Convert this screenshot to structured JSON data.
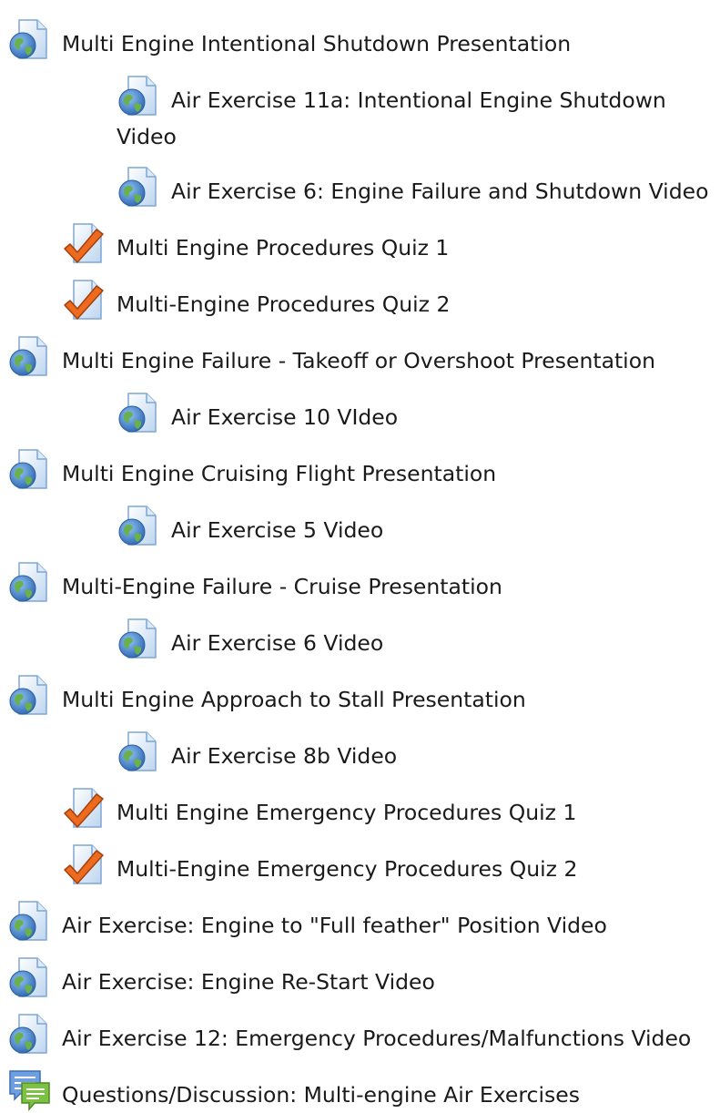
{
  "activities": [
    {
      "label": "Multi Engine Intentional Shutdown Presentation",
      "icon": "url-globe-icon"
    },
    {
      "label": "Air Exercise 11a: Intentional Engine Shutdown Video",
      "icon": "url-globe-icon"
    },
    {
      "label": "Air Exercise 6: Engine Failure and Shutdown Video",
      "icon": "url-globe-icon"
    },
    {
      "label": "Multi Engine Procedures Quiz 1",
      "icon": "quiz-check-icon"
    },
    {
      "label": "Multi-Engine Procedures Quiz 2",
      "icon": "quiz-check-icon"
    },
    {
      "label": "Multi Engine Failure - Takeoff or Overshoot Presentation",
      "icon": "url-globe-icon"
    },
    {
      "label": "Air Exercise 10 VIdeo",
      "icon": "url-globe-icon"
    },
    {
      "label": "Multi Engine Cruising Flight Presentation",
      "icon": "url-globe-icon"
    },
    {
      "label": "Air Exercise 5 Video",
      "icon": "url-globe-icon"
    },
    {
      "label": "Multi-Engine Failure - Cruise Presentation",
      "icon": "url-globe-icon"
    },
    {
      "label": "Air Exercise 6 Video",
      "icon": "url-globe-icon"
    },
    {
      "label": "Multi Engine Approach to Stall Presentation",
      "icon": "url-globe-icon"
    },
    {
      "label": "Air Exercise 8b Video",
      "icon": "url-globe-icon"
    },
    {
      "label": "Multi Engine Emergency Procedures Quiz 1",
      "icon": "quiz-check-icon"
    },
    {
      "label": "Multi-Engine Emergency Procedures Quiz 2",
      "icon": "quiz-check-icon"
    },
    {
      "label": "Air Exercise: Engine to \"Full feather\" Position Video",
      "icon": "url-globe-icon"
    },
    {
      "label": "Air Exercise: Engine Re-Start Video",
      "icon": "url-globe-icon"
    },
    {
      "label": "Air Exercise 12: Emergency Procedures/Malfunctions Video",
      "icon": "url-globe-icon"
    },
    {
      "label": "Questions/Discussion: Multi-engine Air Exercises",
      "icon": "forum-icon"
    }
  ],
  "colors": {
    "text": "#1a1a1a",
    "page_icon": "#c9ddf2",
    "globe_blue": "#3a78c2",
    "globe_green": "#6ab04c",
    "check": "#e8641e",
    "forum_blue": "#5b8fd6",
    "forum_green": "#7cc142"
  }
}
